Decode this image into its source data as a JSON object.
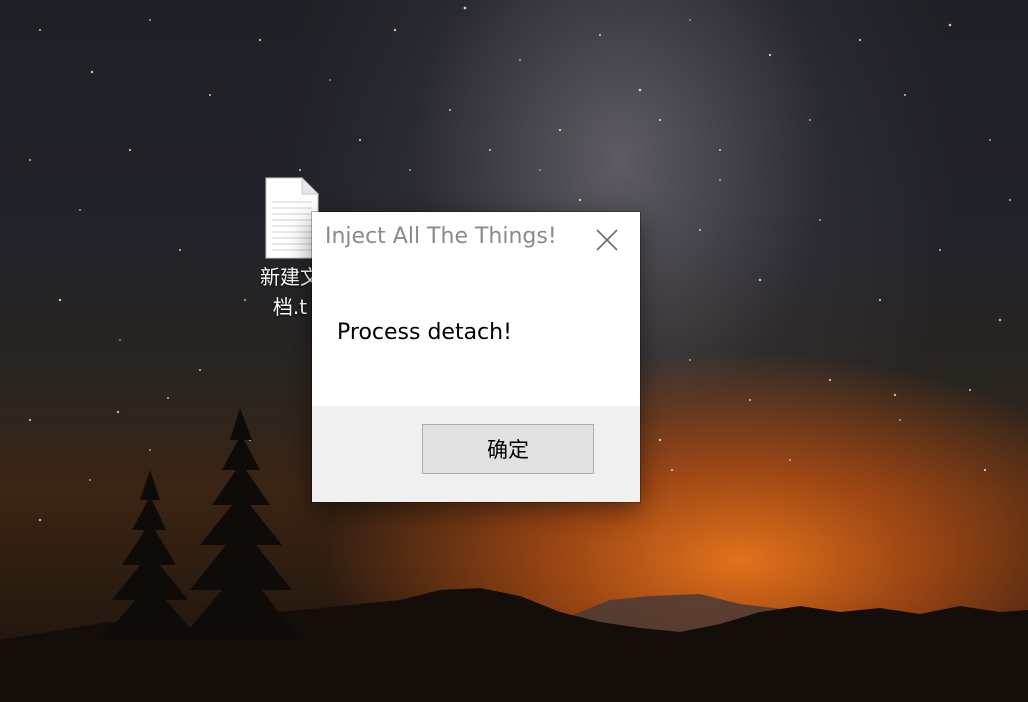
{
  "desktop": {
    "icon": {
      "label_line1": "新建文",
      "label_line2": "档.t",
      "icon_name": "text-file-icon"
    }
  },
  "dialog": {
    "title": "Inject All The Things!",
    "message": "Process detach!",
    "ok_label": "确定",
    "close_icon": "close-icon"
  },
  "colors": {
    "title_text": "#8a8a8a",
    "footer_bg": "#f0f0f0",
    "button_bg": "#e1e1e1",
    "button_border": "#adadad",
    "sunset_glow": "#eb761c"
  }
}
